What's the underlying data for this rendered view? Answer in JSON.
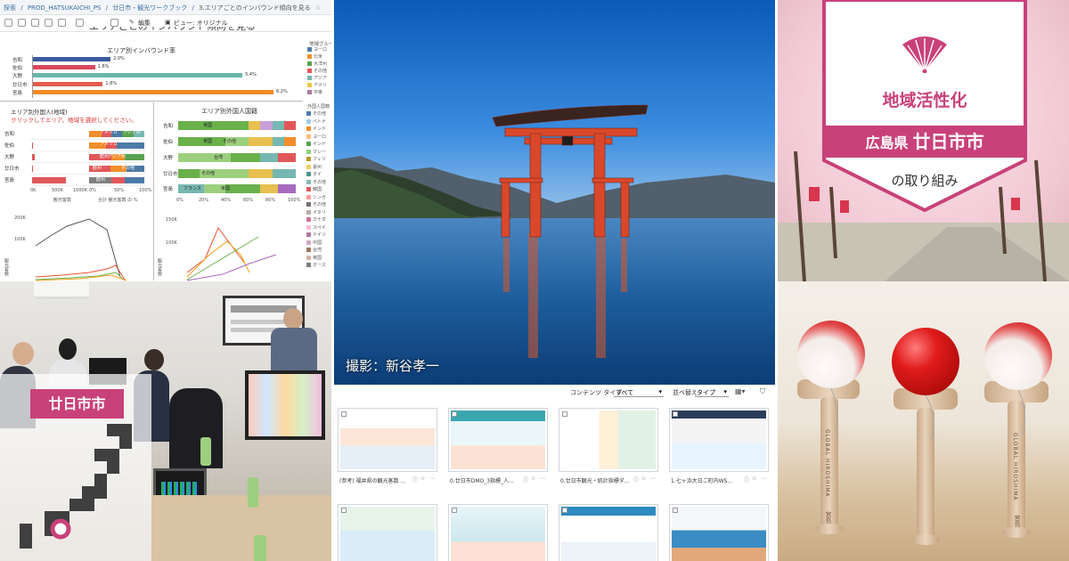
{
  "tableau": {
    "breadcrumb": [
      "探索",
      "/",
      "PROD_HATSUKAICHI_PS",
      "/",
      "廿日市・観光ワークブック",
      "/",
      "3.エリアごとのインバウンド傾向を見る"
    ],
    "toolbar": {
      "edit_label": "編集",
      "view_label": "ビュー: オリジナル"
    },
    "title_partial": "エリアごとのインバウンド傾向を見る",
    "chart1_title": "エリア別インバウンド率",
    "chart1": {
      "categories": [
        "吉和",
        "佐伯",
        "大野",
        "廿日市",
        "宮島"
      ],
      "values_label": [
        "2.0%",
        "1.6%",
        "5.4%",
        "1.8%",
        "6.2%"
      ],
      "values": [
        2.0,
        1.6,
        5.4,
        1.8,
        6.2
      ],
      "colors": [
        "#3b5a9d",
        "#d9475b",
        "#6ab7a8",
        "#e05d4b",
        "#f08a24"
      ]
    },
    "legend1_title": "地域グループ",
    "legend1_items": [
      "ヨーロ",
      "北米",
      "大洋州",
      "その他",
      "アジア",
      "アメリ",
      "中東"
    ],
    "chart2_title": "エリア別外国人(地域)",
    "chart2_instruction": "クリックしてエリア、地域を選択してください。",
    "chart2_rows": [
      "吉和",
      "佐伯",
      "大野",
      "廿日市",
      "宮島"
    ],
    "chart2_axis": [
      "0K",
      "500K",
      "1000K"
    ],
    "chart2_pct_axis": [
      "0%",
      "50%",
      "100%"
    ],
    "chart2_xlabel": "観光客数",
    "chart2_xlabel2": "合計 観光客数 の %",
    "chart2_segments": [
      "アメリカ",
      "アジア州",
      "アメリカ",
      "欧州",
      "アジア州",
      "欧州",
      "その他",
      "欧州"
    ],
    "chart3_title": "エリア別外国人国籍",
    "chart3_rows": [
      "吉和",
      "佐伯",
      "大野",
      "廿日市",
      "宮島"
    ],
    "chart3_segments": [
      "米国",
      "米国",
      "その他",
      "台湾",
      "その他",
      "フランス",
      "米国"
    ],
    "chart3_axis": [
      "0%",
      "20%",
      "40%",
      "60%",
      "80%",
      "100%"
    ],
    "legend2_title": "外国人国籍",
    "legend2_items": [
      "その他",
      "ベトナ",
      "インド",
      "ヨーロ",
      "インド",
      "マレー",
      "フィリ",
      "豪州",
      "タイ",
      "その他",
      "韓国",
      "シンガ",
      "その他",
      "イタリ",
      "カナダ",
      "スペイ",
      "ドイツ",
      "中国",
      "台湾",
      "英国",
      "オース"
    ],
    "line_axis_left": [
      "200K",
      "100K"
    ],
    "line_axis_right": [
      "150K",
      "100K"
    ],
    "line_ylabel": "観光客数"
  },
  "meeting": {
    "city_label": "廿日市市"
  },
  "torii": {
    "credit": "撮影：新谷孝一"
  },
  "dashboards": {
    "filters": {
      "content_type_label": "コンテンツ タイプ:",
      "content_type_value": "すべて",
      "sort_label": "並べ替え",
      "sort_value": "タイプ"
    },
    "cards": [
      {
        "caption": "(参考) 福井県の観光客数 ..."
      },
      {
        "caption": "0.廿日市DMO_3指標_人..."
      },
      {
        "caption": "0.廿日市観光・統計指標ダ..."
      },
      {
        "caption": "1.七ヶ浜大日ご町内WS..."
      }
    ]
  },
  "badge": {
    "title": "地域活性化",
    "location_prefecture": "広島県",
    "location_city": "廿日市市",
    "subtitle": "の取り組み",
    "color": "#c9417a"
  },
  "kendama": {
    "brand_text": "GLOBAL HIROSHIMA",
    "logo_text": "宮島"
  }
}
